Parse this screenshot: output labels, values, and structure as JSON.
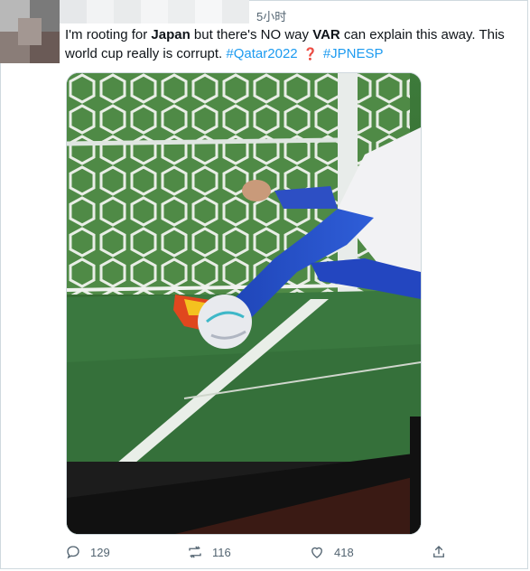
{
  "tweet": {
    "time": "5小时",
    "text": {
      "t1": "I'm rooting for ",
      "b1": "Japan",
      "t2": " but there's NO way ",
      "b2": "VAR",
      "t3": " can explain this away. This world cup really is corrupt. ",
      "hashtag1": "#Qatar2022",
      "emoji": "❓",
      "hashtag2": "#JPNESP"
    }
  },
  "actions": {
    "reply_count": "129",
    "retweet_count": "116",
    "like_count": "418"
  },
  "icons": {
    "reply": "reply-icon",
    "retweet": "retweet-icon",
    "like": "heart-icon",
    "share": "share-icon"
  }
}
